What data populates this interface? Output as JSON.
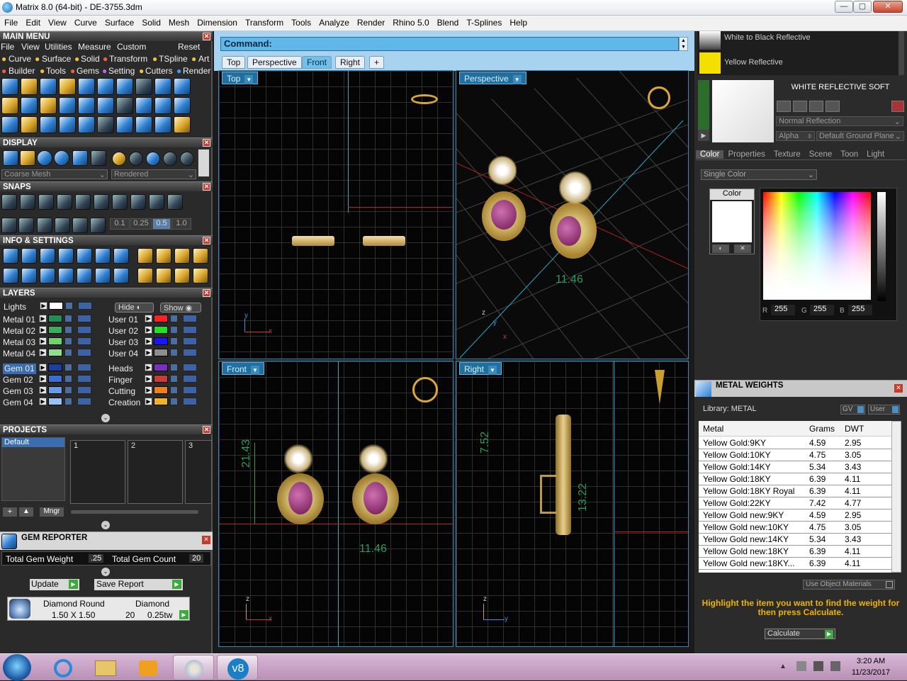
{
  "window": {
    "title": "Matrix 8.0 (64-bit) - DE-3755.3dm",
    "min": "—",
    "max": "▢",
    "close": "✕"
  },
  "menubar": [
    "File",
    "Edit",
    "View",
    "Curve",
    "Surface",
    "Solid",
    "Mesh",
    "Dimension",
    "Transform",
    "Tools",
    "Analyze",
    "Render",
    "Rhino 5.0",
    "Blend",
    "T-Splines",
    "Help"
  ],
  "main_menu": {
    "title": "MAIN MENU",
    "nav": [
      "File",
      "View",
      "Utilities",
      "Measure",
      "Custom",
      "Reset"
    ],
    "row1": [
      "Curve",
      "Surface",
      "Solid",
      "Transform",
      "TSpline",
      "Art"
    ],
    "row2": [
      "Builder",
      "Tools",
      "Gems",
      "Setting",
      "Cutters",
      "Render"
    ]
  },
  "display": {
    "title": "DISPLAY",
    "mesh": "Coarse Mesh",
    "mode": "Rendered"
  },
  "snaps": {
    "title": "SNAPS",
    "values": [
      "0.1",
      "0.25",
      "0.5",
      "1.0"
    ]
  },
  "info": {
    "title": "INFO & SETTINGS"
  },
  "layers": {
    "title": "LAYERS",
    "lights": "Lights",
    "hide": "Hide",
    "show": "Show",
    "left": [
      {
        "name": "Metal 01",
        "color": "#1f8f57"
      },
      {
        "name": "Metal 02",
        "color": "#38b05a"
      },
      {
        "name": "Metal 03",
        "color": "#6ed36a"
      },
      {
        "name": "Metal 04",
        "color": "#8fe08f"
      },
      {
        "name": "Gem 01",
        "color": "#1a3f9e"
      },
      {
        "name": "Gem 02",
        "color": "#3a6fcf"
      },
      {
        "name": "Gem 03",
        "color": "#6a9be6"
      },
      {
        "name": "Gem 04",
        "color": "#9cc0f2"
      }
    ],
    "right": [
      {
        "name": "User 01",
        "color": "#ff2020"
      },
      {
        "name": "User 02",
        "color": "#21e321"
      },
      {
        "name": "User 03",
        "color": "#1717ff"
      },
      {
        "name": "User 04",
        "color": "#8d8d8d"
      },
      {
        "name": "Heads",
        "color": "#7a2fc0"
      },
      {
        "name": "Finger",
        "color": "#c83b3b"
      },
      {
        "name": "Cutting",
        "color": "#f07f1f"
      },
      {
        "name": "Creation",
        "color": "#f0b22a"
      }
    ]
  },
  "projects": {
    "title": "PROJECTS",
    "default": "Default",
    "slots": [
      "1",
      "2",
      "3"
    ],
    "mngr": "Mngr"
  },
  "gem_reporter": {
    "title": "GEM REPORTER",
    "weight_label": "Total Gem Weight",
    "weight": ".25",
    "count_label": "Total Gem Count",
    "count": "20",
    "update": "Update",
    "save": "Save Report",
    "gem_type": "Diamond Round",
    "gem_size": "1.50 X 1.50",
    "gem_material": "Diamond",
    "gem_qty": "20",
    "gem_tw": "0.25tw"
  },
  "command": {
    "label": "Command:"
  },
  "view_tabs": [
    "Top",
    "Perspective",
    "Front",
    "Right",
    "+"
  ],
  "viewports": {
    "top": "Top",
    "perspective": "Perspective",
    "front": "Front",
    "right": "Right"
  },
  "dims": {
    "persp": "11.46",
    "front_h": "21.43",
    "front_w": "11.46",
    "right_a": "7.52",
    "right_b": "13.22"
  },
  "materials": {
    "item1": "White to Black Reflective",
    "item2": "Yellow Reflective",
    "selected": "WHITE REFLECTIVE SOFT",
    "reflection": "Normal Reflection",
    "alpha": "Alpha",
    "ground": "Default Ground Plane"
  },
  "mat_tabs": [
    "Color",
    "Properties",
    "Texture",
    "Scene",
    "Toon",
    "Light"
  ],
  "color": {
    "mode": "Single Color",
    "label": "Color",
    "r_label": "R",
    "r": "255",
    "g_label": "G",
    "g": "255",
    "b_label": "B",
    "b": "255"
  },
  "metal_weights": {
    "title": "METAL WEIGHTS",
    "library": "Library: METAL",
    "gv": "GV",
    "user": "User",
    "cols": [
      "Metal",
      "Grams",
      "DWT"
    ],
    "rows": [
      [
        "Yellow Gold:9KY",
        "4.59",
        "2.95"
      ],
      [
        "Yellow Gold:10KY",
        "4.75",
        "3.05"
      ],
      [
        "Yellow Gold:14KY",
        "5.34",
        "3.43"
      ],
      [
        "Yellow Gold:18KY",
        "6.39",
        "4.11"
      ],
      [
        "Yellow Gold:18KY Royal",
        "6.39",
        "4.11"
      ],
      [
        "Yellow Gold:22KY",
        "7.42",
        "4.77"
      ],
      [
        "Yellow Gold new:9KY",
        "4.59",
        "2.95"
      ],
      [
        "Yellow Gold new:10KY",
        "4.75",
        "3.05"
      ],
      [
        "Yellow Gold new:14KY",
        "5.34",
        "3.43"
      ],
      [
        "Yellow Gold new:18KY",
        "6.39",
        "4.11"
      ],
      [
        "Yellow Gold new:18KY...",
        "6.39",
        "4.11"
      ]
    ],
    "use_obj": "Use Object Materials",
    "hint": "Highlight the item you want to find the weight for then press Calculate.",
    "calculate": "Calculate"
  },
  "tray": {
    "time": "3:20 AM",
    "date": "11/23/2017"
  },
  "colors": {
    "accent": "#5fb8e8",
    "panel": "#2a2a2a",
    "title_bar": "#353535"
  }
}
